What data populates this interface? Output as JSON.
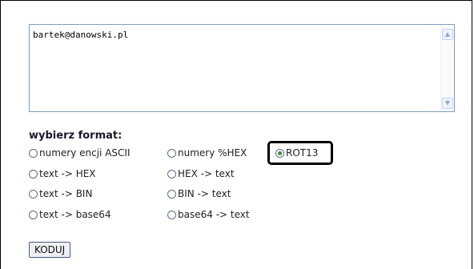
{
  "textarea": {
    "value": "bartek@danowski.pl"
  },
  "format": {
    "title": "wybierz format:",
    "options": [
      {
        "label": "numery encji ASCII",
        "checked": false
      },
      {
        "label": "numery %HEX",
        "checked": false
      },
      {
        "label": "ROT13",
        "checked": true
      },
      {
        "label": "text -> HEX",
        "checked": false
      },
      {
        "label": "HEX -> text",
        "checked": false
      },
      {
        "label": "text -> BIN",
        "checked": false
      },
      {
        "label": "BIN -> text",
        "checked": false
      },
      {
        "label": "text -> base64",
        "checked": false
      },
      {
        "label": "base64 -> text",
        "checked": false
      }
    ]
  },
  "submit_label": "KODUJ"
}
